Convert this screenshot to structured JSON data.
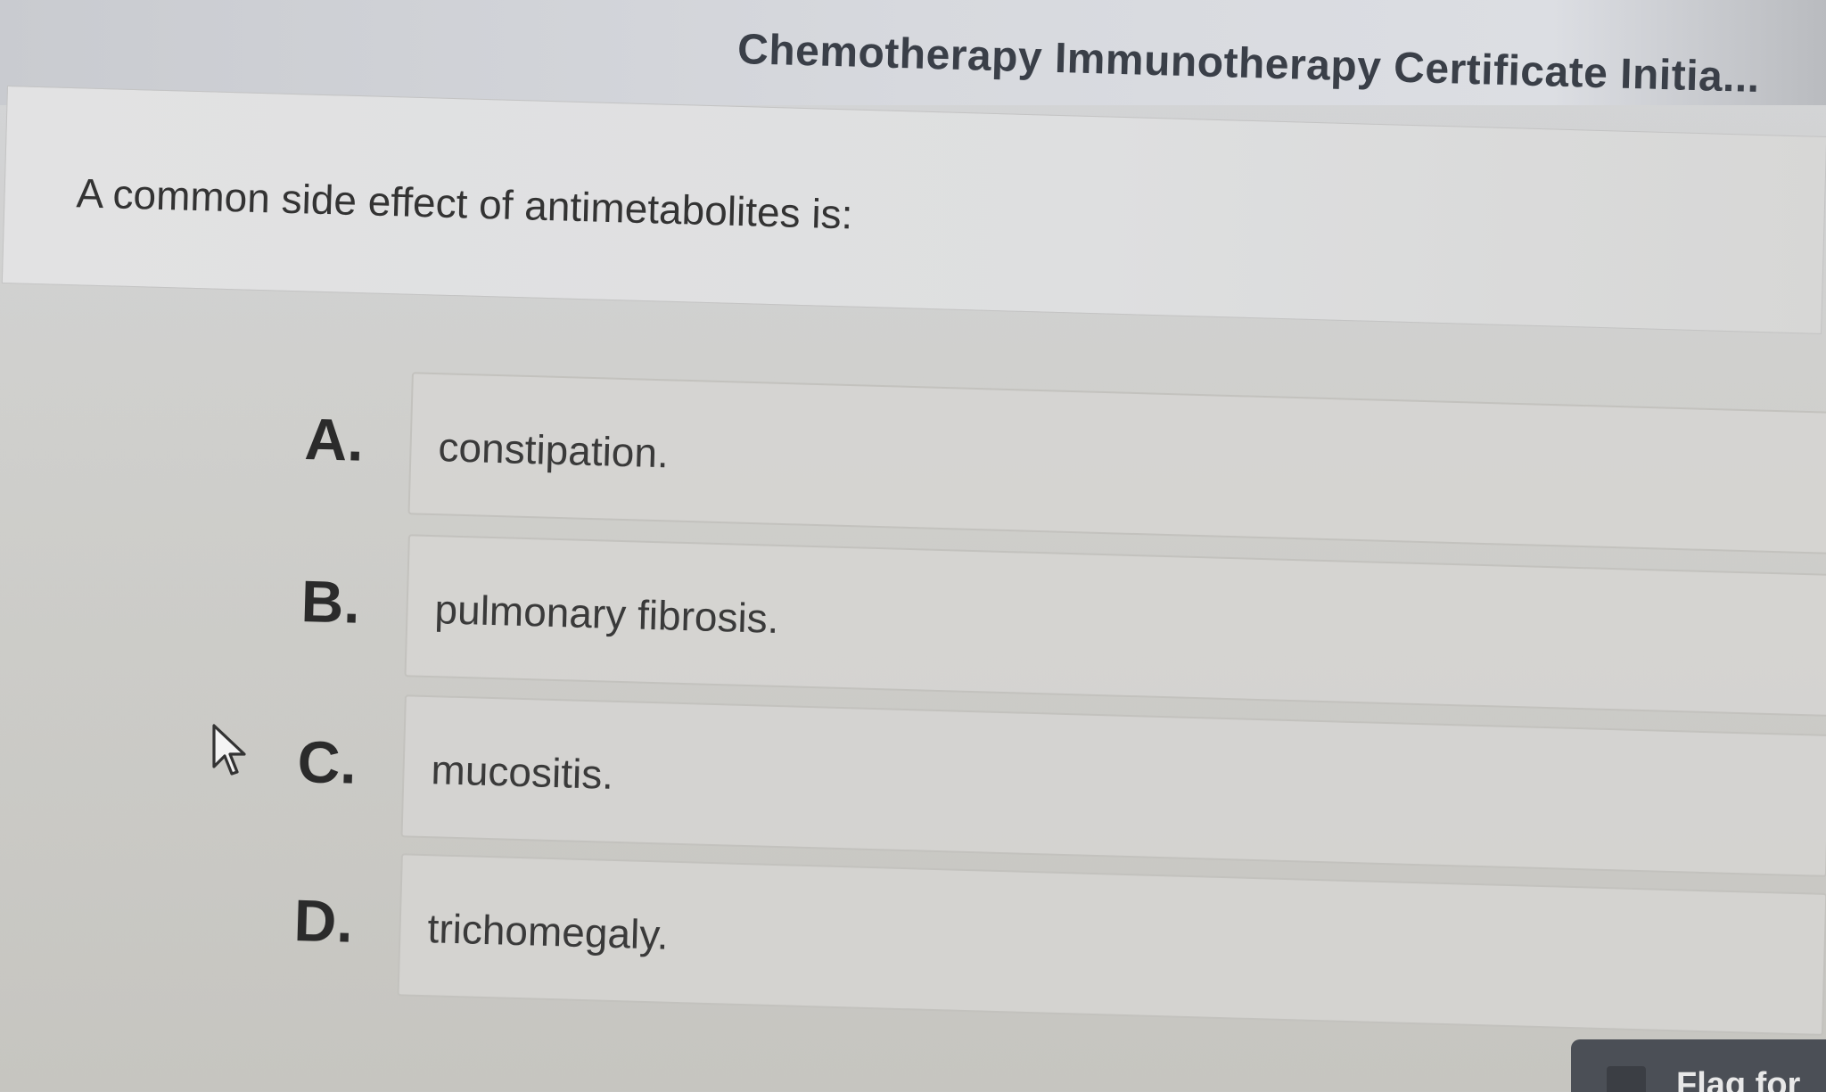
{
  "header": {
    "title": "Chemotherapy Immunotherapy Certificate Initia..."
  },
  "question": {
    "text": "A common side effect of antimetabolites is:"
  },
  "options": [
    {
      "letter": "A.",
      "text": "constipation."
    },
    {
      "letter": "B.",
      "text": "pulmonary fibrosis."
    },
    {
      "letter": "C.",
      "text": "mucositis."
    },
    {
      "letter": "D.",
      "text": "trichomegaly."
    }
  ],
  "footer": {
    "flag_label": "Flag for"
  },
  "colors": {
    "header_text": "#3a3f48",
    "flag_button": "#4b4f56"
  }
}
